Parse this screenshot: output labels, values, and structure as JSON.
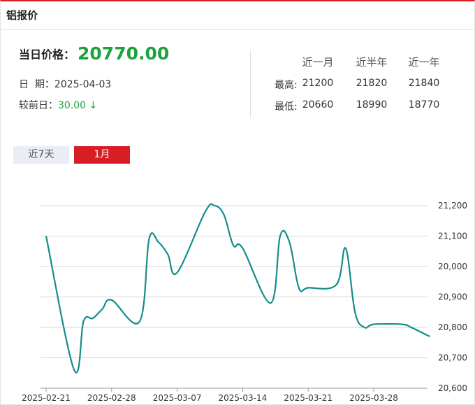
{
  "header": {
    "title": "铝报价"
  },
  "summary": {
    "price_label": "当日价格：",
    "price_value": "20770.00",
    "date_label": "日  期：",
    "date_value": "2025-04-03",
    "change_label": "较前日：",
    "change_value": "30.00",
    "change_arrow": "↓",
    "price_color": "#1aa33c"
  },
  "stats": {
    "columns": [
      "近一月",
      "近半年",
      "近一年"
    ],
    "rows": [
      {
        "label": "最高:",
        "values": [
          "21200",
          "21820",
          "21840"
        ]
      },
      {
        "label": "最低:",
        "values": [
          "20660",
          "18990",
          "18770"
        ]
      }
    ]
  },
  "tabs": [
    {
      "label": "近7天",
      "active": false
    },
    {
      "label": "1月",
      "active": true
    }
  ],
  "colors": {
    "accent": "#d71e24",
    "line": "#148c8c"
  },
  "chart_data": {
    "type": "line",
    "x_ticks": [
      "2025-02-21",
      "2025-02-28",
      "2025-03-07",
      "2025-03-14",
      "2025-03-21",
      "2025-03-28"
    ],
    "ylim": [
      20600,
      21200
    ],
    "y_ticks": [
      20600,
      20700,
      20800,
      20900,
      21000,
      21100,
      21200
    ],
    "y_tick_labels": [
      "20,600",
      "20,700",
      "20,800",
      "20,900",
      "20,000",
      "21,100",
      "21,200"
    ],
    "grid": true,
    "series": [
      {
        "x": [
          "2025-02-21",
          "2025-02-24",
          "2025-02-25",
          "2025-02-26",
          "2025-02-27",
          "2025-02-28",
          "2025-03-03",
          "2025-03-04",
          "2025-03-05",
          "2025-03-06",
          "2025-03-07",
          "2025-03-10",
          "2025-03-11",
          "2025-03-12",
          "2025-03-13",
          "2025-03-14",
          "2025-03-17",
          "2025-03-18",
          "2025-03-19",
          "2025-03-20",
          "2025-03-21",
          "2025-03-24",
          "2025-03-25",
          "2025-03-26",
          "2025-03-27",
          "2025-03-28",
          "2025-03-31",
          "2025-04-01",
          "2025-04-02",
          "2025-04-03"
        ],
        "values": [
          21100,
          20660,
          20820,
          20830,
          20860,
          20890,
          20820,
          21090,
          21080,
          21040,
          20980,
          21180,
          21200,
          21170,
          21070,
          21060,
          20880,
          21100,
          21080,
          20930,
          20930,
          20940,
          21060,
          20850,
          20800,
          20810,
          20810,
          20800,
          20785,
          20770
        ]
      }
    ]
  }
}
